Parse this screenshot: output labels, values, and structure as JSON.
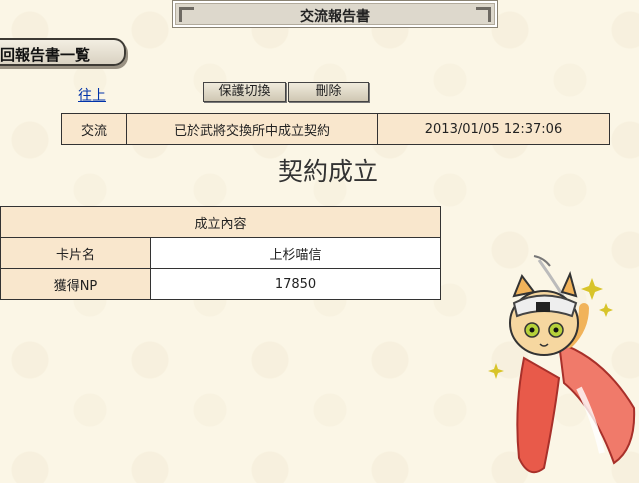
{
  "title": "交流報告書",
  "section_tab": "回報告書一覧",
  "back_link": "往上",
  "buttons": {
    "protect_toggle": "保護切換",
    "delete": "刪除"
  },
  "report": {
    "category": "交流",
    "message": "已於武將交換所中成立契約",
    "timestamp": "2013/01/05 12:37:06"
  },
  "headline": "契約成立",
  "details": {
    "header": "成立內容",
    "rows": [
      {
        "label": "卡片名",
        "value": "上杉喵信"
      },
      {
        "label": "獲得NP",
        "value": "17850"
      }
    ]
  }
}
